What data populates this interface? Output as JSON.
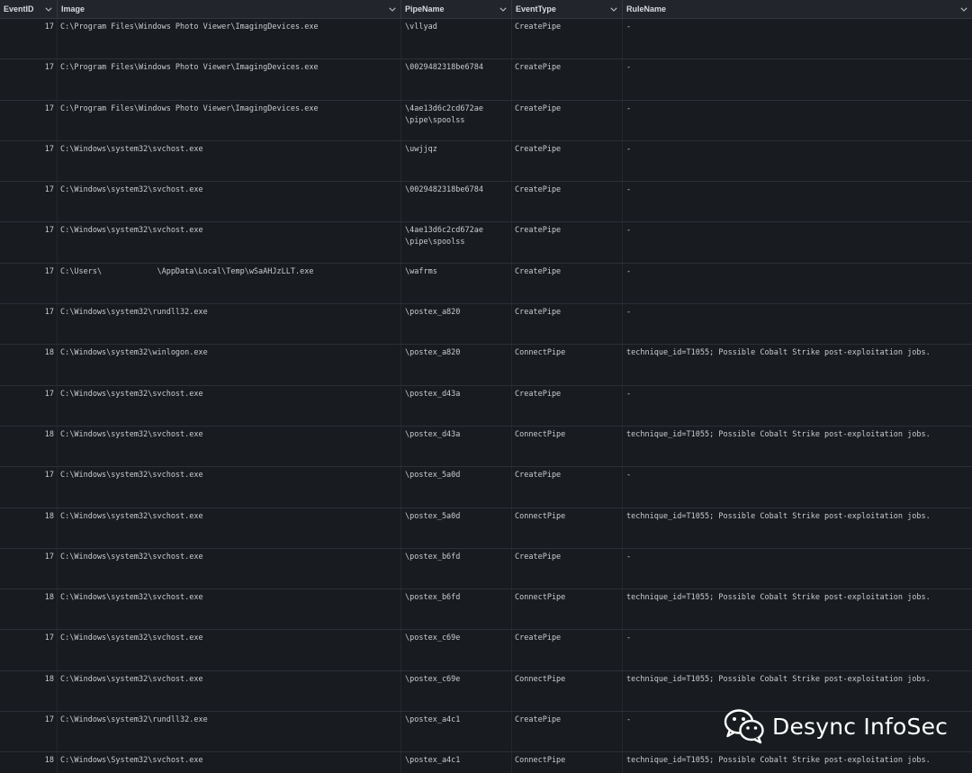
{
  "columns": [
    {
      "key": "eventid",
      "label": "EventID"
    },
    {
      "key": "image",
      "label": "Image"
    },
    {
      "key": "pipe",
      "label": "PipeName"
    },
    {
      "key": "type",
      "label": "EventType"
    },
    {
      "key": "rule",
      "label": "RuleName"
    }
  ],
  "rows": [
    {
      "eventid": "17",
      "image": "C:\\Program Files\\Windows Photo Viewer\\ImagingDevices.exe",
      "pipe": "\\vllyad",
      "type": "CreatePipe",
      "rule": "-"
    },
    {
      "eventid": "17",
      "image": "C:\\Program Files\\Windows Photo Viewer\\ImagingDevices.exe",
      "pipe": "\\0029482318be6784",
      "type": "CreatePipe",
      "rule": "-"
    },
    {
      "eventid": "17",
      "image": "C:\\Program Files\\Windows Photo Viewer\\ImagingDevices.exe",
      "pipe": "\\4ae13d6c2cd672ae\n\\pipe\\spoolss",
      "type": "CreatePipe",
      "rule": "-"
    },
    {
      "eventid": "17",
      "image": "C:\\Windows\\system32\\svchost.exe",
      "pipe": "\\uwjjqz",
      "type": "CreatePipe",
      "rule": "-"
    },
    {
      "eventid": "17",
      "image": "C:\\Windows\\system32\\svchost.exe",
      "pipe": "\\0029482318be6784",
      "type": "CreatePipe",
      "rule": "-"
    },
    {
      "eventid": "17",
      "image": "C:\\Windows\\system32\\svchost.exe",
      "pipe": "\\4ae13d6c2cd672ae\n\\pipe\\spoolss",
      "type": "CreatePipe",
      "rule": "-"
    },
    {
      "eventid": "17",
      "image": "C:\\Users\\            \\AppData\\Local\\Temp\\wSaAHJzLLT.exe",
      "pipe": "\\wafrms",
      "type": "CreatePipe",
      "rule": "-"
    },
    {
      "eventid": "17",
      "image": "C:\\Windows\\system32\\rundll32.exe",
      "pipe": "\\postex_a820",
      "type": "CreatePipe",
      "rule": "-"
    },
    {
      "eventid": "18",
      "image": "C:\\Windows\\system32\\winlogon.exe",
      "pipe": "\\postex_a820",
      "type": "ConnectPipe",
      "rule": "technique_id=T1055; Possible Cobalt Strike post-exploitation jobs."
    },
    {
      "eventid": "17",
      "image": "C:\\Windows\\system32\\svchost.exe",
      "pipe": "\\postex_d43a",
      "type": "CreatePipe",
      "rule": "-"
    },
    {
      "eventid": "18",
      "image": "C:\\Windows\\system32\\svchost.exe",
      "pipe": "\\postex_d43a",
      "type": "ConnectPipe",
      "rule": "technique_id=T1055; Possible Cobalt Strike post-exploitation jobs."
    },
    {
      "eventid": "17",
      "image": "C:\\Windows\\system32\\svchost.exe",
      "pipe": "\\postex_5a0d",
      "type": "CreatePipe",
      "rule": "-"
    },
    {
      "eventid": "18",
      "image": "C:\\Windows\\system32\\svchost.exe",
      "pipe": "\\postex_5a0d",
      "type": "ConnectPipe",
      "rule": "technique_id=T1055; Possible Cobalt Strike post-exploitation jobs."
    },
    {
      "eventid": "17",
      "image": "C:\\Windows\\system32\\svchost.exe",
      "pipe": "\\postex_b6fd",
      "type": "CreatePipe",
      "rule": "-"
    },
    {
      "eventid": "18",
      "image": "C:\\Windows\\system32\\svchost.exe",
      "pipe": "\\postex_b6fd",
      "type": "ConnectPipe",
      "rule": "technique_id=T1055; Possible Cobalt Strike post-exploitation jobs."
    },
    {
      "eventid": "17",
      "image": "C:\\Windows\\system32\\svchost.exe",
      "pipe": "\\postex_c69e",
      "type": "CreatePipe",
      "rule": "-"
    },
    {
      "eventid": "18",
      "image": "C:\\Windows\\system32\\svchost.exe",
      "pipe": "\\postex_c69e",
      "type": "ConnectPipe",
      "rule": "technique_id=T1055; Possible Cobalt Strike post-exploitation jobs."
    },
    {
      "eventid": "17",
      "image": "C:\\Windows\\system32\\rundll32.exe",
      "pipe": "\\postex_a4c1",
      "type": "CreatePipe",
      "rule": "-"
    },
    {
      "eventid": "18",
      "image": "C:\\Windows\\System32\\svchost.exe",
      "pipe": "\\postex_a4c1",
      "type": "ConnectPipe",
      "rule": "technique_id=T1055; Possible Cobalt Strike post-exploitation jobs."
    }
  ],
  "watermark": {
    "text": "Desync InfoSec",
    "logo_icon": "wechat-logo-icon"
  },
  "colors": {
    "background": "#181b1f",
    "header_background": "#22252b",
    "text": "#c9ccd1",
    "border": "#2c2f35"
  }
}
